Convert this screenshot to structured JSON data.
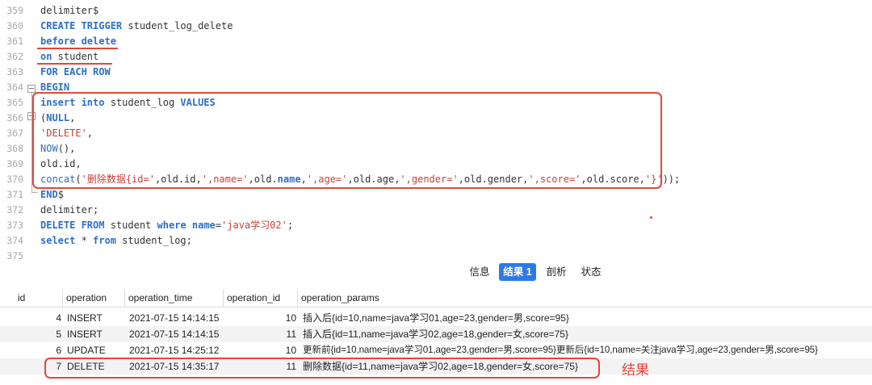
{
  "editor": {
    "lines": [
      {
        "n": "359",
        "tokens": [
          {
            "t": "delimiter$",
            "c": ""
          }
        ]
      },
      {
        "n": "360",
        "tokens": [
          {
            "t": "CREATE TRIGGER",
            "c": "k"
          },
          {
            "t": " student_log_delete",
            "c": ""
          }
        ]
      },
      {
        "n": "361",
        "tokens": [
          {
            "t": "before delete",
            "c": "k"
          }
        ]
      },
      {
        "n": "362",
        "tokens": [
          {
            "t": "on",
            "c": "k"
          },
          {
            "t": " student",
            "c": ""
          }
        ]
      },
      {
        "n": "363",
        "tokens": [
          {
            "t": "FOR EACH ROW",
            "c": "k"
          }
        ]
      },
      {
        "n": "364",
        "tokens": [
          {
            "t": "BEGIN",
            "c": "k"
          }
        ]
      },
      {
        "n": "365",
        "tokens": [
          {
            "t": "insert into",
            "c": "k"
          },
          {
            "t": " student_log ",
            "c": ""
          },
          {
            "t": "VALUES",
            "c": "k"
          }
        ]
      },
      {
        "n": "366",
        "tokens": [
          {
            "t": "(",
            "c": ""
          },
          {
            "t": "NULL",
            "c": "k"
          },
          {
            "t": ",",
            "c": ""
          }
        ]
      },
      {
        "n": "367",
        "tokens": [
          {
            "t": "'DELETE'",
            "c": "s"
          },
          {
            "t": ",",
            "c": ""
          }
        ]
      },
      {
        "n": "368",
        "tokens": [
          {
            "t": "NOW",
            "c": "f"
          },
          {
            "t": "(),",
            "c": ""
          }
        ]
      },
      {
        "n": "369",
        "tokens": [
          {
            "t": "old.id,",
            "c": ""
          }
        ]
      },
      {
        "n": "370",
        "tokens": [
          {
            "t": "concat",
            "c": "f"
          },
          {
            "t": "(",
            "c": ""
          },
          {
            "t": "'删除数据{id='",
            "c": "s"
          },
          {
            "t": ",old.id,",
            "c": ""
          },
          {
            "t": "',name='",
            "c": "s"
          },
          {
            "t": ",old.",
            "c": ""
          },
          {
            "t": "name",
            "c": "k"
          },
          {
            "t": ",",
            "c": ""
          },
          {
            "t": "',age='",
            "c": "s"
          },
          {
            "t": ",old.age,",
            "c": ""
          },
          {
            "t": "',gender='",
            "c": "s"
          },
          {
            "t": ",old.gender,",
            "c": ""
          },
          {
            "t": "',score='",
            "c": "s"
          },
          {
            "t": ",old.score,",
            "c": ""
          },
          {
            "t": "'}'",
            "c": "s"
          },
          {
            "t": "));",
            "c": ""
          }
        ]
      },
      {
        "n": "371",
        "tokens": [
          {
            "t": "END",
            "c": "k"
          },
          {
            "t": "$",
            "c": ""
          }
        ]
      },
      {
        "n": "372",
        "tokens": [
          {
            "t": "delimiter;",
            "c": ""
          }
        ]
      },
      {
        "n": "373",
        "tokens": [
          {
            "t": "DELETE FROM",
            "c": "k"
          },
          {
            "t": " student ",
            "c": ""
          },
          {
            "t": "where",
            "c": "k"
          },
          {
            "t": " ",
            "c": ""
          },
          {
            "t": "name",
            "c": "k"
          },
          {
            "t": "=",
            "c": ""
          },
          {
            "t": "'java学习02'",
            "c": "s"
          },
          {
            "t": ";",
            "c": ""
          }
        ]
      },
      {
        "n": "374",
        "tokens": [
          {
            "t": "select",
            "c": "k"
          },
          {
            "t": " * ",
            "c": ""
          },
          {
            "t": "from",
            "c": "k"
          },
          {
            "t": " student_log;",
            "c": ""
          }
        ]
      },
      {
        "n": "375",
        "tokens": []
      }
    ]
  },
  "tabs": {
    "info": "信息",
    "result1": "结果 1",
    "profile": "剖析",
    "status": "状态"
  },
  "grid": {
    "columns": [
      "id",
      "operation",
      "operation_time",
      "operation_id",
      "operation_params"
    ],
    "rows": [
      {
        "id": "4",
        "operation": "INSERT",
        "operation_time": "2021-07-15 14:14:15",
        "operation_id": "10",
        "operation_params": "插入后{id=10,name=java学习01,age=23,gender=男,score=95}"
      },
      {
        "id": "5",
        "operation": "INSERT",
        "operation_time": "2021-07-15 14:14:15",
        "operation_id": "11",
        "operation_params": "插入后{id=11,name=java学习02,age=18,gender=女,score=75}"
      },
      {
        "id": "6",
        "operation": "UPDATE",
        "operation_time": "2021-07-15 14:25:12",
        "operation_id": "10",
        "operation_params": "更新前{id=10,name=java学习01,age=23,gender=男,score=95}更新后{id=10,name=关注java学习,age=23,gender=男,score=95}"
      },
      {
        "id": "7",
        "operation": "DELETE",
        "operation_time": "2021-07-15 14:35:17",
        "operation_id": "11",
        "operation_params": "删除数据{id=11,name=java学习02,age=18,gender=女,score=75}"
      }
    ]
  },
  "annotation": {
    "label": "结果"
  },
  "colors": {
    "accent": "#2c7be5",
    "highlight": "#e3473a",
    "keyword": "#2d6fc4",
    "string": "#c4413a"
  }
}
